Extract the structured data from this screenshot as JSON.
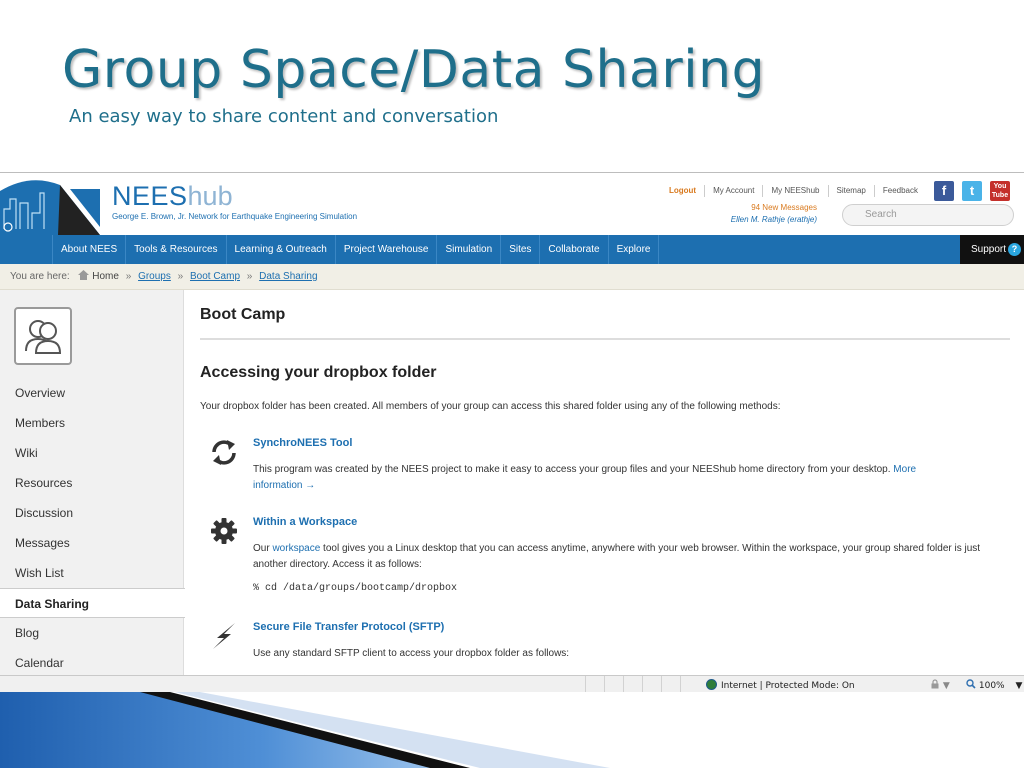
{
  "slide": {
    "title": "Group Space/Data Sharing",
    "subtitle": "An easy way to share content and conversation"
  },
  "site": {
    "brand_main": "NEES",
    "brand_sub": "hub",
    "tagline": "George E. Brown, Jr. Network for Earthquake Engineering Simulation",
    "top_links": [
      "Logout",
      "My Account",
      "My NEEShub",
      "Sitemap",
      "Feedback"
    ],
    "messages": "94 New Messages",
    "user": "Ellen M. Rathje (erathje)",
    "search_placeholder": "Search",
    "social": {
      "facebook": "f",
      "twitter": "t",
      "youtube_1": "You",
      "youtube_2": "Tube"
    }
  },
  "nav": {
    "items": [
      "About NEES",
      "Tools & Resources",
      "Learning & Outreach",
      "Project Warehouse",
      "Simulation",
      "Sites",
      "Collaborate",
      "Explore"
    ],
    "support": "Support",
    "support_icon": "?"
  },
  "breadcrumb": {
    "prefix": "You are here:",
    "home": "Home",
    "separator": "»",
    "items": [
      "Groups",
      "Boot Camp",
      "Data Sharing"
    ]
  },
  "sidebar": {
    "items": [
      "Overview",
      "Members",
      "Wiki",
      "Resources",
      "Discussion",
      "Messages",
      "Wish List",
      "Data Sharing",
      "Blog",
      "Calendar"
    ],
    "active": "Data Sharing"
  },
  "main": {
    "heading": "Boot Camp",
    "section_heading": "Accessing your dropbox folder",
    "intro": "Your dropbox folder has been created. All members of your group can access this shared folder using any of the following methods:",
    "methods": [
      {
        "icon": "sync-arrows-icon",
        "title": "SynchroNEES Tool",
        "text": "This program was created by the NEES project to make it easy to access your group files and your NEEShub home directory from your desktop.",
        "link_1": "More",
        "link_2": "information →"
      },
      {
        "icon": "gear-icon",
        "title": "Within a Workspace",
        "text_before": "Our",
        "link": "workspace",
        "text_after": "tool gives you a Linux desktop that you can access anytime, anywhere with your web browser. Within the workspace, your group shared folder is just another directory. Access it as follows:",
        "code": "% cd /data/groups/bootcamp/dropbox"
      },
      {
        "icon": "lightning-icon",
        "title": "Secure File Transfer Protocol (SFTP)",
        "text": "Use any standard SFTP client to access your dropbox folder as follows:"
      }
    ]
  },
  "status_bar": {
    "zone": "Internet | Protected Mode: On",
    "zoom": "100%",
    "zoom_arrow": "▼",
    "lock_arrow": "▼"
  },
  "colors": {
    "title": "#1f6f8b",
    "brand_blue": "#1d6fb0",
    "nav_bg": "#1d6fb0",
    "accent_orange": "#d97a1f"
  }
}
